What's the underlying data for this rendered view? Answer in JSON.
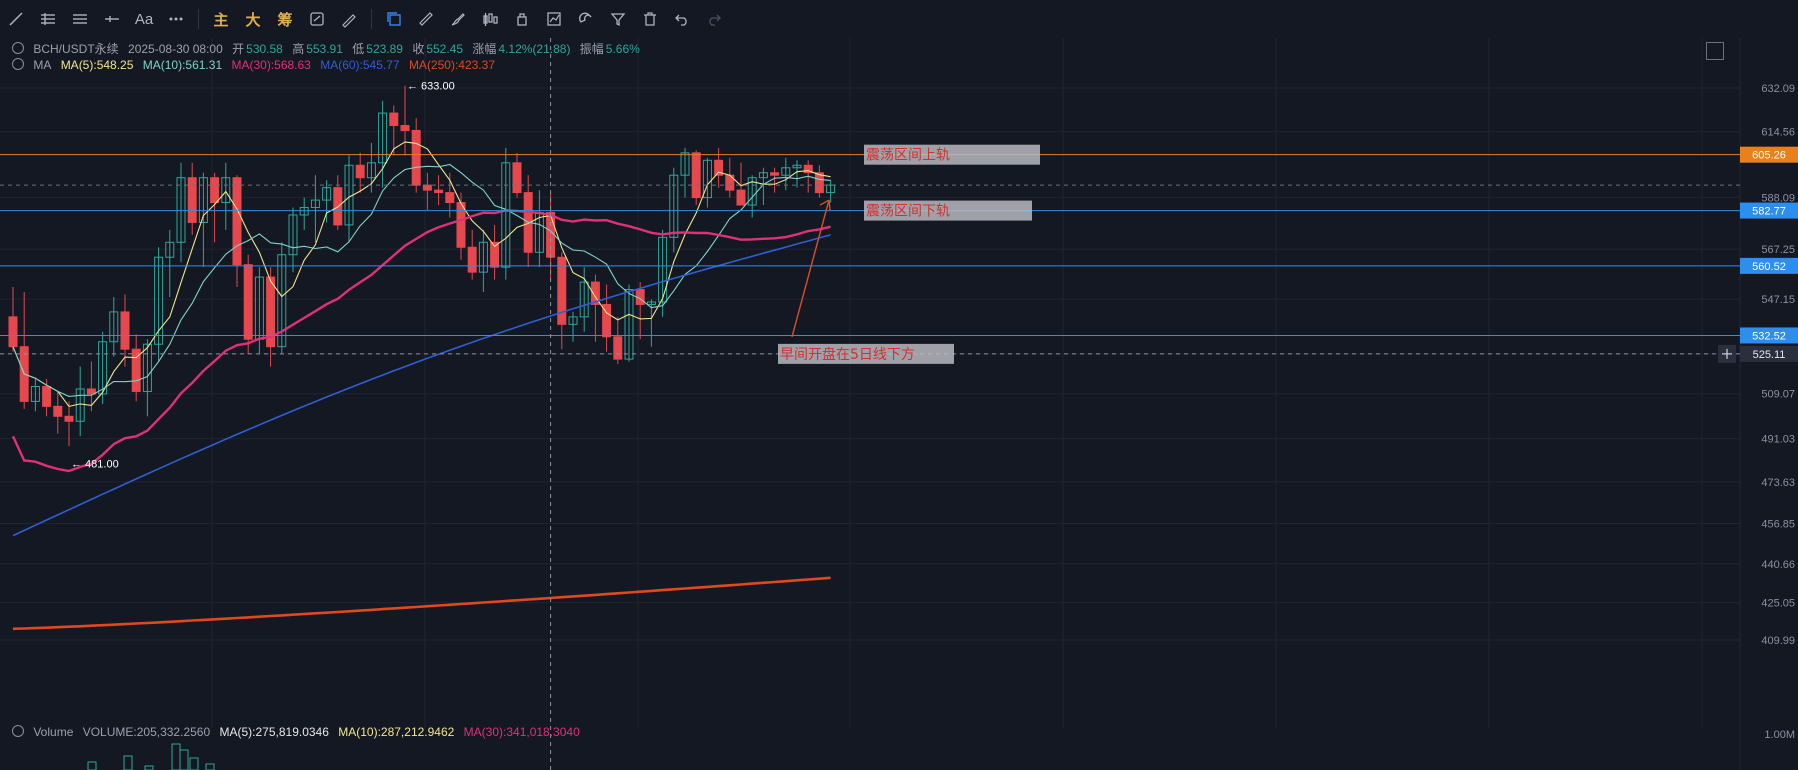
{
  "toolbar": {
    "icons": [
      "trendline-icon",
      "parallel-lines-icon",
      "horizontal-lines-icon",
      "cross-line-icon",
      "text-icon",
      "more-icon"
    ],
    "text_label": "Aa",
    "cn_buttons": [
      "主",
      "大",
      "筹"
    ],
    "right_icons": [
      "copy-icon",
      "ruler-icon",
      "brush-icon",
      "candle-icon",
      "lock-icon",
      "chart-box-icon",
      "magnet-icon",
      "filter-icon",
      "trash-icon",
      "undo-icon",
      "redo-icon"
    ]
  },
  "header": {
    "symbol": "BCH/USDT永续",
    "date": "2025-08-30 08:00",
    "open_label": "开",
    "open": "530.58",
    "high_label": "高",
    "high": "553.91",
    "low_label": "低",
    "low": "523.89",
    "close_label": "收",
    "close": "552.45",
    "change_label": "涨幅",
    "change": "4.12%(21.88)",
    "amp_label": "振幅",
    "amp": "5.66%"
  },
  "ma_legend": {
    "label": "MA",
    "ma5": "MA(5):548.25",
    "ma10": "MA(10):561.31",
    "ma30": "MA(30):568.63",
    "ma60": "MA(60):545.77",
    "ma250": "MA(250):423.37"
  },
  "volume_legend": {
    "label": "Volume",
    "volume": "VOLUME:205,332.2560",
    "ma5": "MA(5):275,819.0346",
    "ma10": "MA(10):287,212.9462",
    "ma30": "MA(30):341,018.3040"
  },
  "colors": {
    "up": "#2ea79b",
    "down": "#e5484d",
    "ma5": "#f2e58c",
    "ma10": "#7fd3c8",
    "ma30": "#e0307a",
    "ma60": "#2f5fd0",
    "ma250": "#e0481e",
    "hline_orange": "#e8801c",
    "hline_blue": "#2c8ff0"
  },
  "chart_data": {
    "type": "candlestick",
    "ylim": [
      405,
      640
    ],
    "y_ticks": [
      "632.09",
      "614.56",
      "588.09",
      "567.25",
      "547.15",
      "525.11",
      "509.07",
      "491.03",
      "473.63",
      "456.85",
      "440.66",
      "425.05",
      "409.99"
    ],
    "volume_tick": "1.00M",
    "candles": [
      [
        540,
        552,
        526,
        528
      ],
      [
        528,
        550,
        503,
        506
      ],
      [
        506,
        515,
        502,
        512
      ],
      [
        512,
        515,
        500,
        504
      ],
      [
        504,
        510,
        493,
        500
      ],
      [
        500,
        506,
        488,
        498
      ],
      [
        498,
        520,
        492,
        511
      ],
      [
        511,
        522,
        502,
        509
      ],
      [
        509,
        534,
        505,
        530
      ],
      [
        530,
        548,
        524,
        542
      ],
      [
        542,
        549,
        520,
        527
      ],
      [
        527,
        533,
        506,
        510
      ],
      [
        510,
        531,
        500,
        529
      ],
      [
        529,
        568,
        522,
        564
      ],
      [
        564,
        575,
        548,
        570
      ],
      [
        570,
        602,
        562,
        596
      ],
      [
        596,
        602,
        573,
        578
      ],
      [
        578,
        598,
        560,
        596
      ],
      [
        596,
        598,
        570,
        586
      ],
      [
        586,
        602,
        575,
        596
      ],
      [
        596,
        597,
        552,
        561
      ],
      [
        561,
        565,
        525,
        531
      ],
      [
        531,
        560,
        525,
        556
      ],
      [
        556,
        560,
        520,
        528
      ],
      [
        528,
        570,
        525,
        565
      ],
      [
        565,
        584,
        558,
        581
      ],
      [
        581,
        588,
        575,
        584
      ],
      [
        584,
        597,
        570,
        587
      ],
      [
        587,
        595,
        578,
        592
      ],
      [
        592,
        597,
        575,
        577
      ],
      [
        577,
        605,
        570,
        601
      ],
      [
        601,
        606,
        590,
        596
      ],
      [
        596,
        610,
        590,
        602
      ],
      [
        602,
        627,
        592,
        622
      ],
      [
        622,
        625,
        605,
        617
      ],
      [
        617,
        633,
        605,
        615
      ],
      [
        615,
        620,
        590,
        593
      ],
      [
        593,
        598,
        583,
        591
      ],
      [
        591,
        597,
        585,
        590
      ],
      [
        590,
        598,
        580,
        586
      ],
      [
        586,
        590,
        563,
        568
      ],
      [
        568,
        575,
        555,
        558
      ],
      [
        558,
        575,
        550,
        570
      ],
      [
        570,
        577,
        555,
        560
      ],
      [
        560,
        608,
        555,
        602
      ],
      [
        602,
        606,
        588,
        590
      ],
      [
        590,
        597,
        560,
        566
      ],
      [
        566,
        591,
        560,
        582
      ],
      [
        582,
        590,
        555,
        564
      ],
      [
        564,
        566,
        527,
        537
      ],
      [
        537,
        542,
        530,
        540
      ],
      [
        540,
        560,
        534,
        554
      ],
      [
        554,
        557,
        530,
        545
      ],
      [
        545,
        553,
        526,
        532
      ],
      [
        532,
        540,
        521,
        523
      ],
      [
        523,
        553,
        522,
        551
      ],
      [
        551,
        554,
        531,
        545
      ],
      [
        545,
        547,
        528,
        546
      ],
      [
        546,
        575,
        540,
        572
      ],
      [
        572,
        600,
        566,
        597
      ],
      [
        597,
        608,
        588,
        606
      ],
      [
        606,
        607,
        585,
        588
      ],
      [
        588,
        604,
        584,
        603
      ],
      [
        603,
        608,
        592,
        597
      ],
      [
        597,
        604,
        588,
        591
      ],
      [
        591,
        602,
        586,
        585
      ],
      [
        585,
        597,
        580,
        596
      ],
      [
        596,
        600,
        585,
        598
      ],
      [
        598,
        600,
        590,
        597
      ],
      [
        597,
        604,
        591,
        600
      ],
      [
        600,
        603,
        592,
        601
      ],
      [
        601,
        603,
        590,
        598
      ],
      [
        598,
        601,
        588,
        590
      ],
      [
        590,
        595,
        586,
        593
      ]
    ],
    "annotations": [
      {
        "text": "633.00",
        "price": 633,
        "candle": 35
      },
      {
        "text": "481.00",
        "price": 481,
        "candle": 5
      },
      {
        "text": "震荡区间上轨",
        "price": 605.26
      },
      {
        "text": "震荡区间下轨",
        "price": 582.77
      },
      {
        "text": "早间开盘在5日线下方",
        "price": 525.11
      }
    ],
    "horizontal_lines": [
      {
        "price": 605.26,
        "label": "605.26",
        "color": "orange"
      },
      {
        "price": 582.77,
        "label": "582.77",
        "color": "blue"
      },
      {
        "price": 560.52,
        "label": "560.52",
        "color": "blue"
      },
      {
        "price": 532.52,
        "label": "532.52",
        "color": "blue"
      }
    ],
    "crosshair": {
      "price": 525.11,
      "label": "525.11"
    },
    "ma250": {
      "start": 414.5,
      "end": 435
    }
  }
}
